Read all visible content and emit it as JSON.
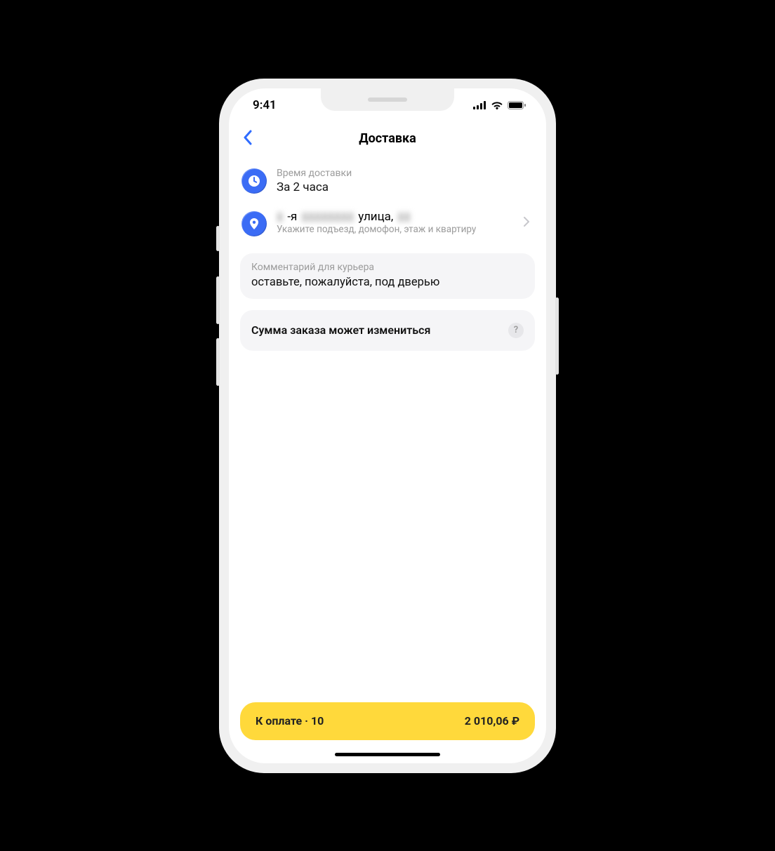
{
  "status_bar": {
    "time": "9:41"
  },
  "nav": {
    "title": "Доставка"
  },
  "delivery_time": {
    "label": "Время доставки",
    "value": "За 2 часа"
  },
  "address": {
    "masked_prefix": "▮",
    "sep": "-я",
    "masked_name": "▮▮▮▮▮▮▮▮",
    "suffix": "улица,",
    "masked_num": "▮▮",
    "hint": "Укажите подъезд, домофон, этаж и квартиру"
  },
  "comment": {
    "label": "Комментарий для курьера",
    "text": "оставьте, пожалуйста, под дверью"
  },
  "notice": {
    "text": "Сумма заказа может измениться"
  },
  "pay": {
    "left": "К оплате · 10",
    "right": "2 010,06 ₽"
  }
}
